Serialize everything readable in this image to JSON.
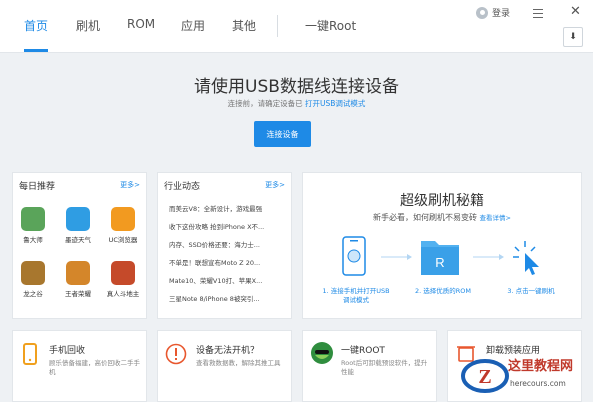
{
  "tabs": [
    {
      "label": "首页",
      "active": true
    },
    {
      "label": "刷机"
    },
    {
      "label": "ROM"
    },
    {
      "label": "应用"
    },
    {
      "label": "其他"
    },
    {
      "label": "一键Root"
    }
  ],
  "header": {
    "login_label": "登录",
    "menu_icon": "hamburger-menu-icon",
    "close_icon": "close-icon",
    "download_icon": "download-icon"
  },
  "hero": {
    "title": "请使用USB数据线连接设备",
    "subtitle_prefix": "连接前，请确定设备已",
    "subtitle_link": "打开USB调试模式",
    "button": "连接设备"
  },
  "daily": {
    "title": "每日推荐",
    "more": "更多>",
    "apps": [
      {
        "name": "鲁大师",
        "color": "#5aa45a"
      },
      {
        "name": "墨迹天气",
        "color": "#2f9de3"
      },
      {
        "name": "UC浏览器",
        "color": "#f29a20"
      },
      {
        "name": "龙之谷",
        "color": "#a8772e"
      },
      {
        "name": "王者荣耀",
        "color": "#d4862a"
      },
      {
        "name": "真人斗地主",
        "color": "#c54a2a"
      }
    ]
  },
  "news": {
    "title": "行业动态",
    "more": "更多>",
    "items": [
      "而美云V8：全新设计，游戏最强",
      "收下这份攻略 抢到iPhone X不...",
      "内存、SSD价格还要：海力士...",
      "不单是！联想宣布Moto Z 20...",
      "Mate10、荣耀V10打、苹果X...",
      "三星Note 8/iPhone 8被突引..."
    ]
  },
  "flash": {
    "title": "超级刷机秘籍",
    "subtitle": "新手必看，如何刷机不易变砖",
    "link": "查看详情>",
    "steps": [
      "1. 连接手机并打开USB调试模式",
      "2. 选择优质的ROM",
      "3. 点击一键刷机"
    ]
  },
  "services": [
    {
      "title": "手机回收",
      "desc": "顾乐债备福建，高价回收二手手机"
    },
    {
      "title": "设备无法开机？",
      "desc": "查看救数据教，解除其推工具"
    },
    {
      "title": "一键ROOT",
      "desc": "Root后可卸载预设软件，提升性能"
    },
    {
      "title": "卸载预装应用",
      "desc": "清理手机空间"
    }
  ],
  "watermark": {
    "text": "这里教程网",
    "url": "herecours.com"
  }
}
